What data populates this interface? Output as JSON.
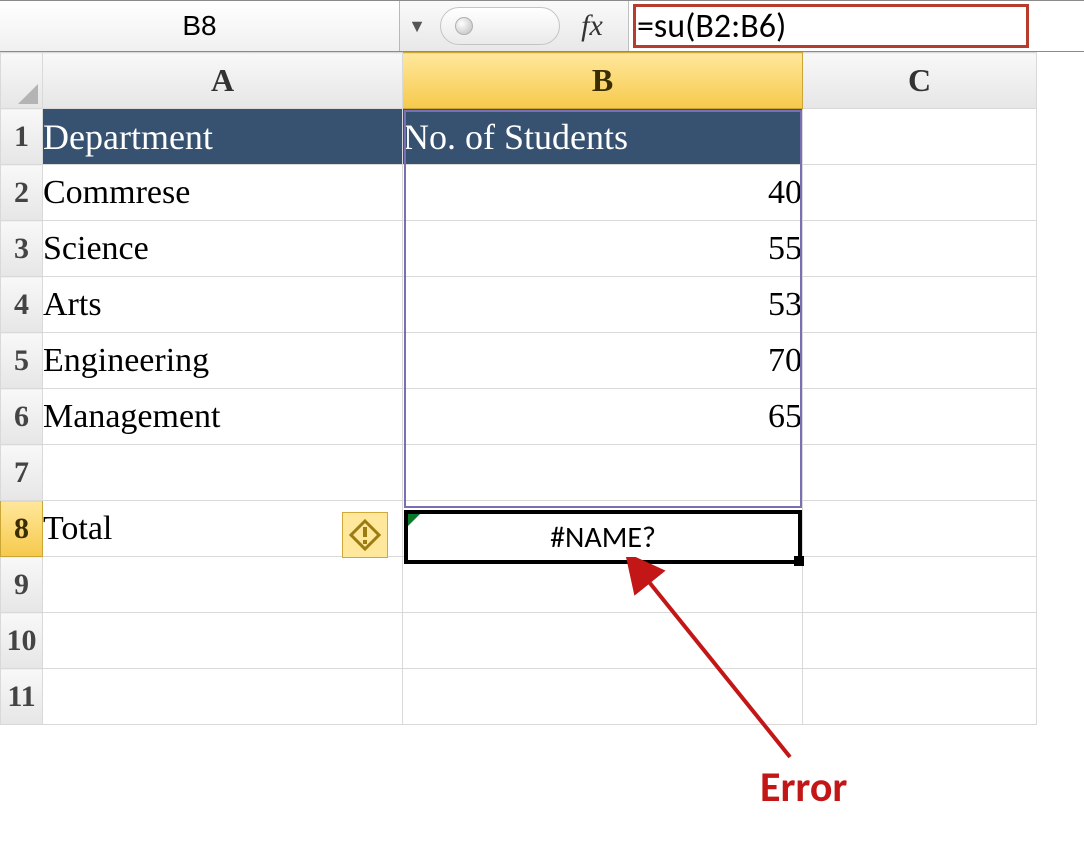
{
  "formula_bar": {
    "name_box": "B8",
    "fx_label": "fx",
    "formula": "=su(B2:B6)"
  },
  "columns": {
    "A": "A",
    "B": "B",
    "C": "C"
  },
  "rows": [
    "1",
    "2",
    "3",
    "4",
    "5",
    "6",
    "7",
    "8",
    "9",
    "10",
    "11"
  ],
  "header_row": {
    "A": "Department",
    "B": "No. of Students"
  },
  "data": [
    {
      "dept": "Commrese",
      "students": "40"
    },
    {
      "dept": "Science",
      "students": "55"
    },
    {
      "dept": "Arts",
      "students": "53"
    },
    {
      "dept": "Engineering",
      "students": "70"
    },
    {
      "dept": "Management",
      "students": "65"
    }
  ],
  "total_row": {
    "label": "Total",
    "value": "#NAME?"
  },
  "active_cell": "B8",
  "referenced_range": "B2:B6",
  "annotation": {
    "label": "Error"
  }
}
